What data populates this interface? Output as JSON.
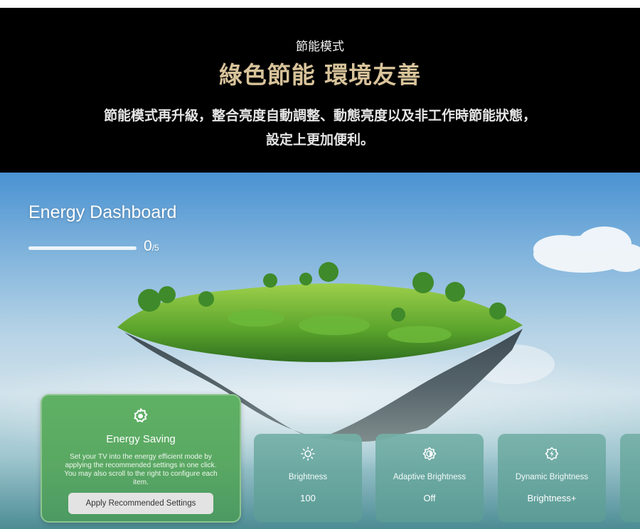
{
  "promo": {
    "kicker": "節能模式",
    "headline": "綠色節能 環境友善",
    "body_line1": "節能模式再升級，整合亮度自動調整、動態亮度以及非工作時節能狀態，",
    "body_line2": "設定上更加便利。"
  },
  "dashboard": {
    "title": "Energy Dashboard",
    "progress": {
      "done": "0",
      "separator": "/",
      "total": "5",
      "fraction": 0
    }
  },
  "hero_card": {
    "icon": "energy-saving-gear-icon",
    "title": "Energy Saving",
    "description": "Set your TV into the energy efficient mode by applying the recommended settings in one click. You may also scroll to the right to configure each item.",
    "button_label": "Apply Recommended Settings"
  },
  "settings": [
    {
      "icon": "sun-icon",
      "label": "Brightness",
      "value": "100"
    },
    {
      "icon": "adaptive-brightness-icon",
      "label": "Adaptive Brightness",
      "value": "Off"
    },
    {
      "icon": "dynamic-brightness-icon",
      "label": "Dynamic Brightness",
      "value": "Brightness+"
    }
  ],
  "colors": {
    "headline_gold": "#d8c39a",
    "hero_card_green": "#5aa863",
    "setting_card_teal": "#6aa9a1",
    "sky_blue": "#4a92d2"
  }
}
